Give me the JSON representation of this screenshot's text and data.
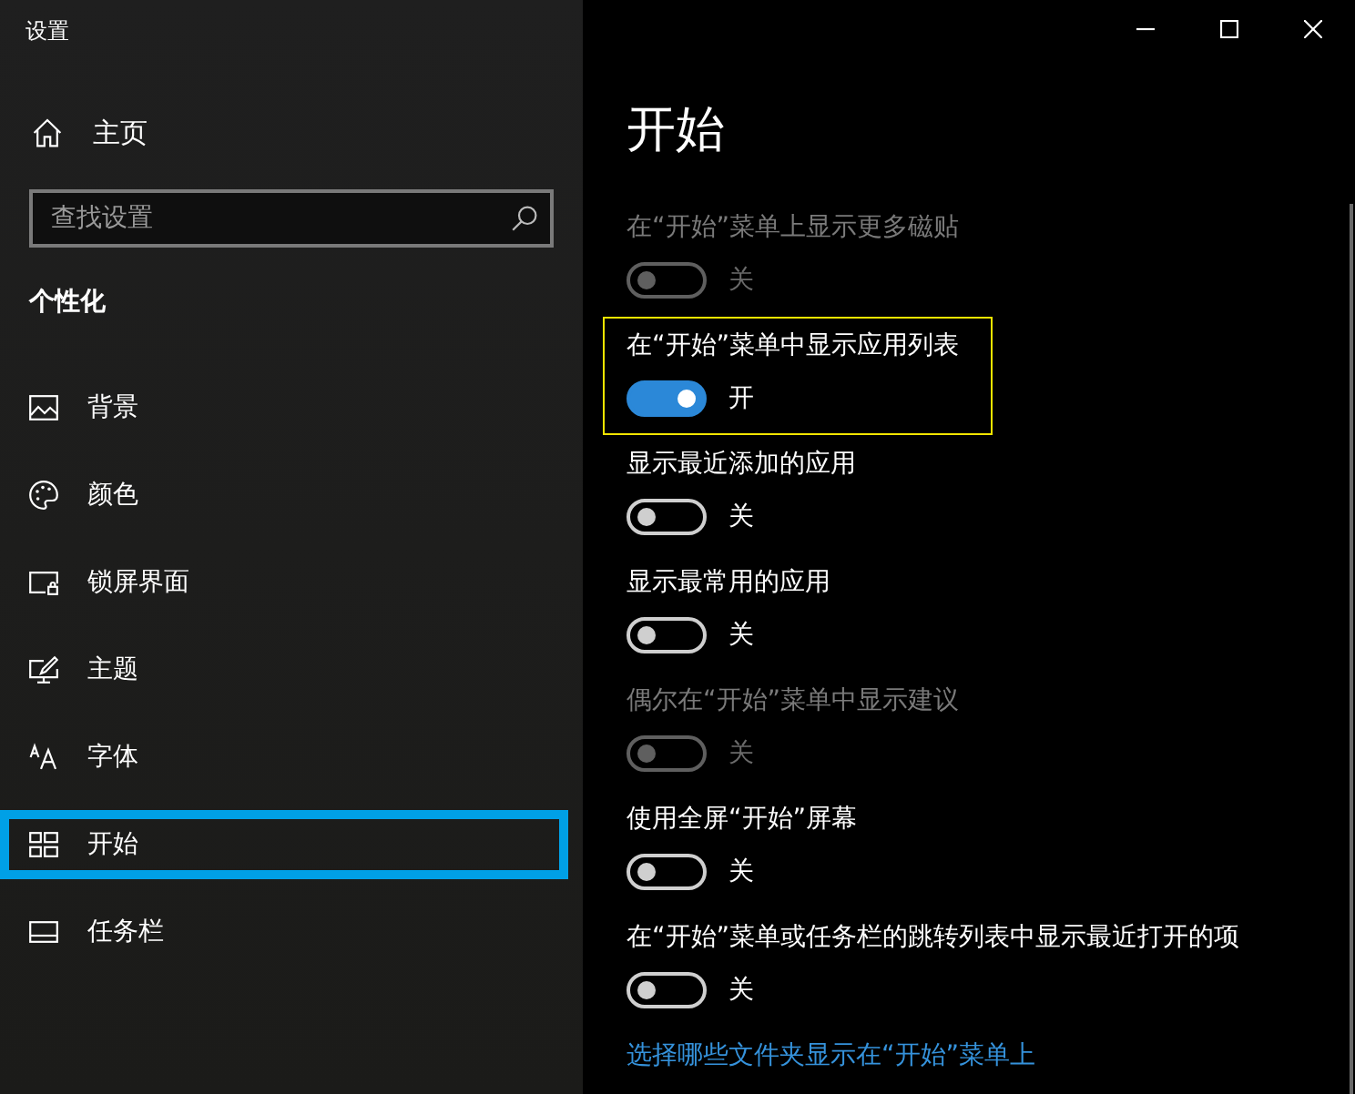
{
  "window": {
    "title": "设置"
  },
  "sidebar": {
    "home": "主页",
    "search": {
      "placeholder": "查找设置"
    },
    "section": "个性化",
    "items": [
      {
        "label": "背景",
        "selected": false
      },
      {
        "label": "颜色",
        "selected": false
      },
      {
        "label": "锁屏界面",
        "selected": false
      },
      {
        "label": "主题",
        "selected": false
      },
      {
        "label": "字体",
        "selected": false
      },
      {
        "label": "开始",
        "selected": true
      },
      {
        "label": "任务栏",
        "selected": false
      }
    ]
  },
  "page": {
    "title": "开始",
    "settings": [
      {
        "label": "在“开始”菜单上显示更多磁贴",
        "on": false,
        "state_text": "关",
        "disabled": true,
        "highlighted": false
      },
      {
        "label": "在“开始”菜单中显示应用列表",
        "on": true,
        "state_text": "开",
        "disabled": false,
        "highlighted": true
      },
      {
        "label": "显示最近添加的应用",
        "on": false,
        "state_text": "关",
        "disabled": false,
        "highlighted": false
      },
      {
        "label": "显示最常用的应用",
        "on": false,
        "state_text": "关",
        "disabled": false,
        "highlighted": false
      },
      {
        "label": "偶尔在“开始”菜单中显示建议",
        "on": false,
        "state_text": "关",
        "disabled": true,
        "highlighted": false
      },
      {
        "label": "使用全屏“开始”屏幕",
        "on": false,
        "state_text": "关",
        "disabled": false,
        "highlighted": false
      },
      {
        "label": "在“开始”菜单或任务栏的跳转列表中显示最近打开的项",
        "on": false,
        "state_text": "关",
        "disabled": false,
        "highlighted": false
      }
    ],
    "link": "选择哪些文件夹显示在“开始”菜单上"
  }
}
